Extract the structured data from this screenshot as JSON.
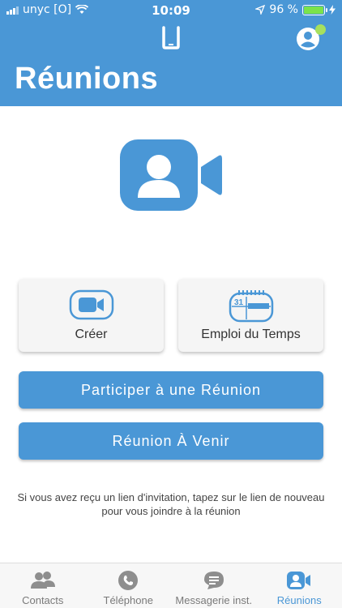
{
  "status_bar": {
    "carrier": "unyc [O]",
    "time": "10:09",
    "battery_percent": "96 %"
  },
  "header": {
    "title": "Réunions"
  },
  "actions": {
    "create_label": "Créer",
    "schedule_label": "Emploi du Temps",
    "calendar_day": "31",
    "join_label": "Participer à une Réunion",
    "upcoming_label": "Réunion À Venir"
  },
  "hint_text": "Si vous avez reçu un lien d'invitation, tapez sur le lien de nouveau pour vous joindre à la réunion",
  "tabs": [
    {
      "label": "Contacts",
      "icon": "contacts-icon"
    },
    {
      "label": "Téléphone",
      "icon": "phone-icon"
    },
    {
      "label": "Messagerie inst.",
      "icon": "chat-icon"
    },
    {
      "label": "Réunions",
      "icon": "meeting-icon",
      "active": true
    }
  ],
  "colors": {
    "primary": "#4a97d6",
    "battery": "#7be34b",
    "online_dot": "#a6e05e",
    "inactive_tab": "#7a7a7a"
  }
}
